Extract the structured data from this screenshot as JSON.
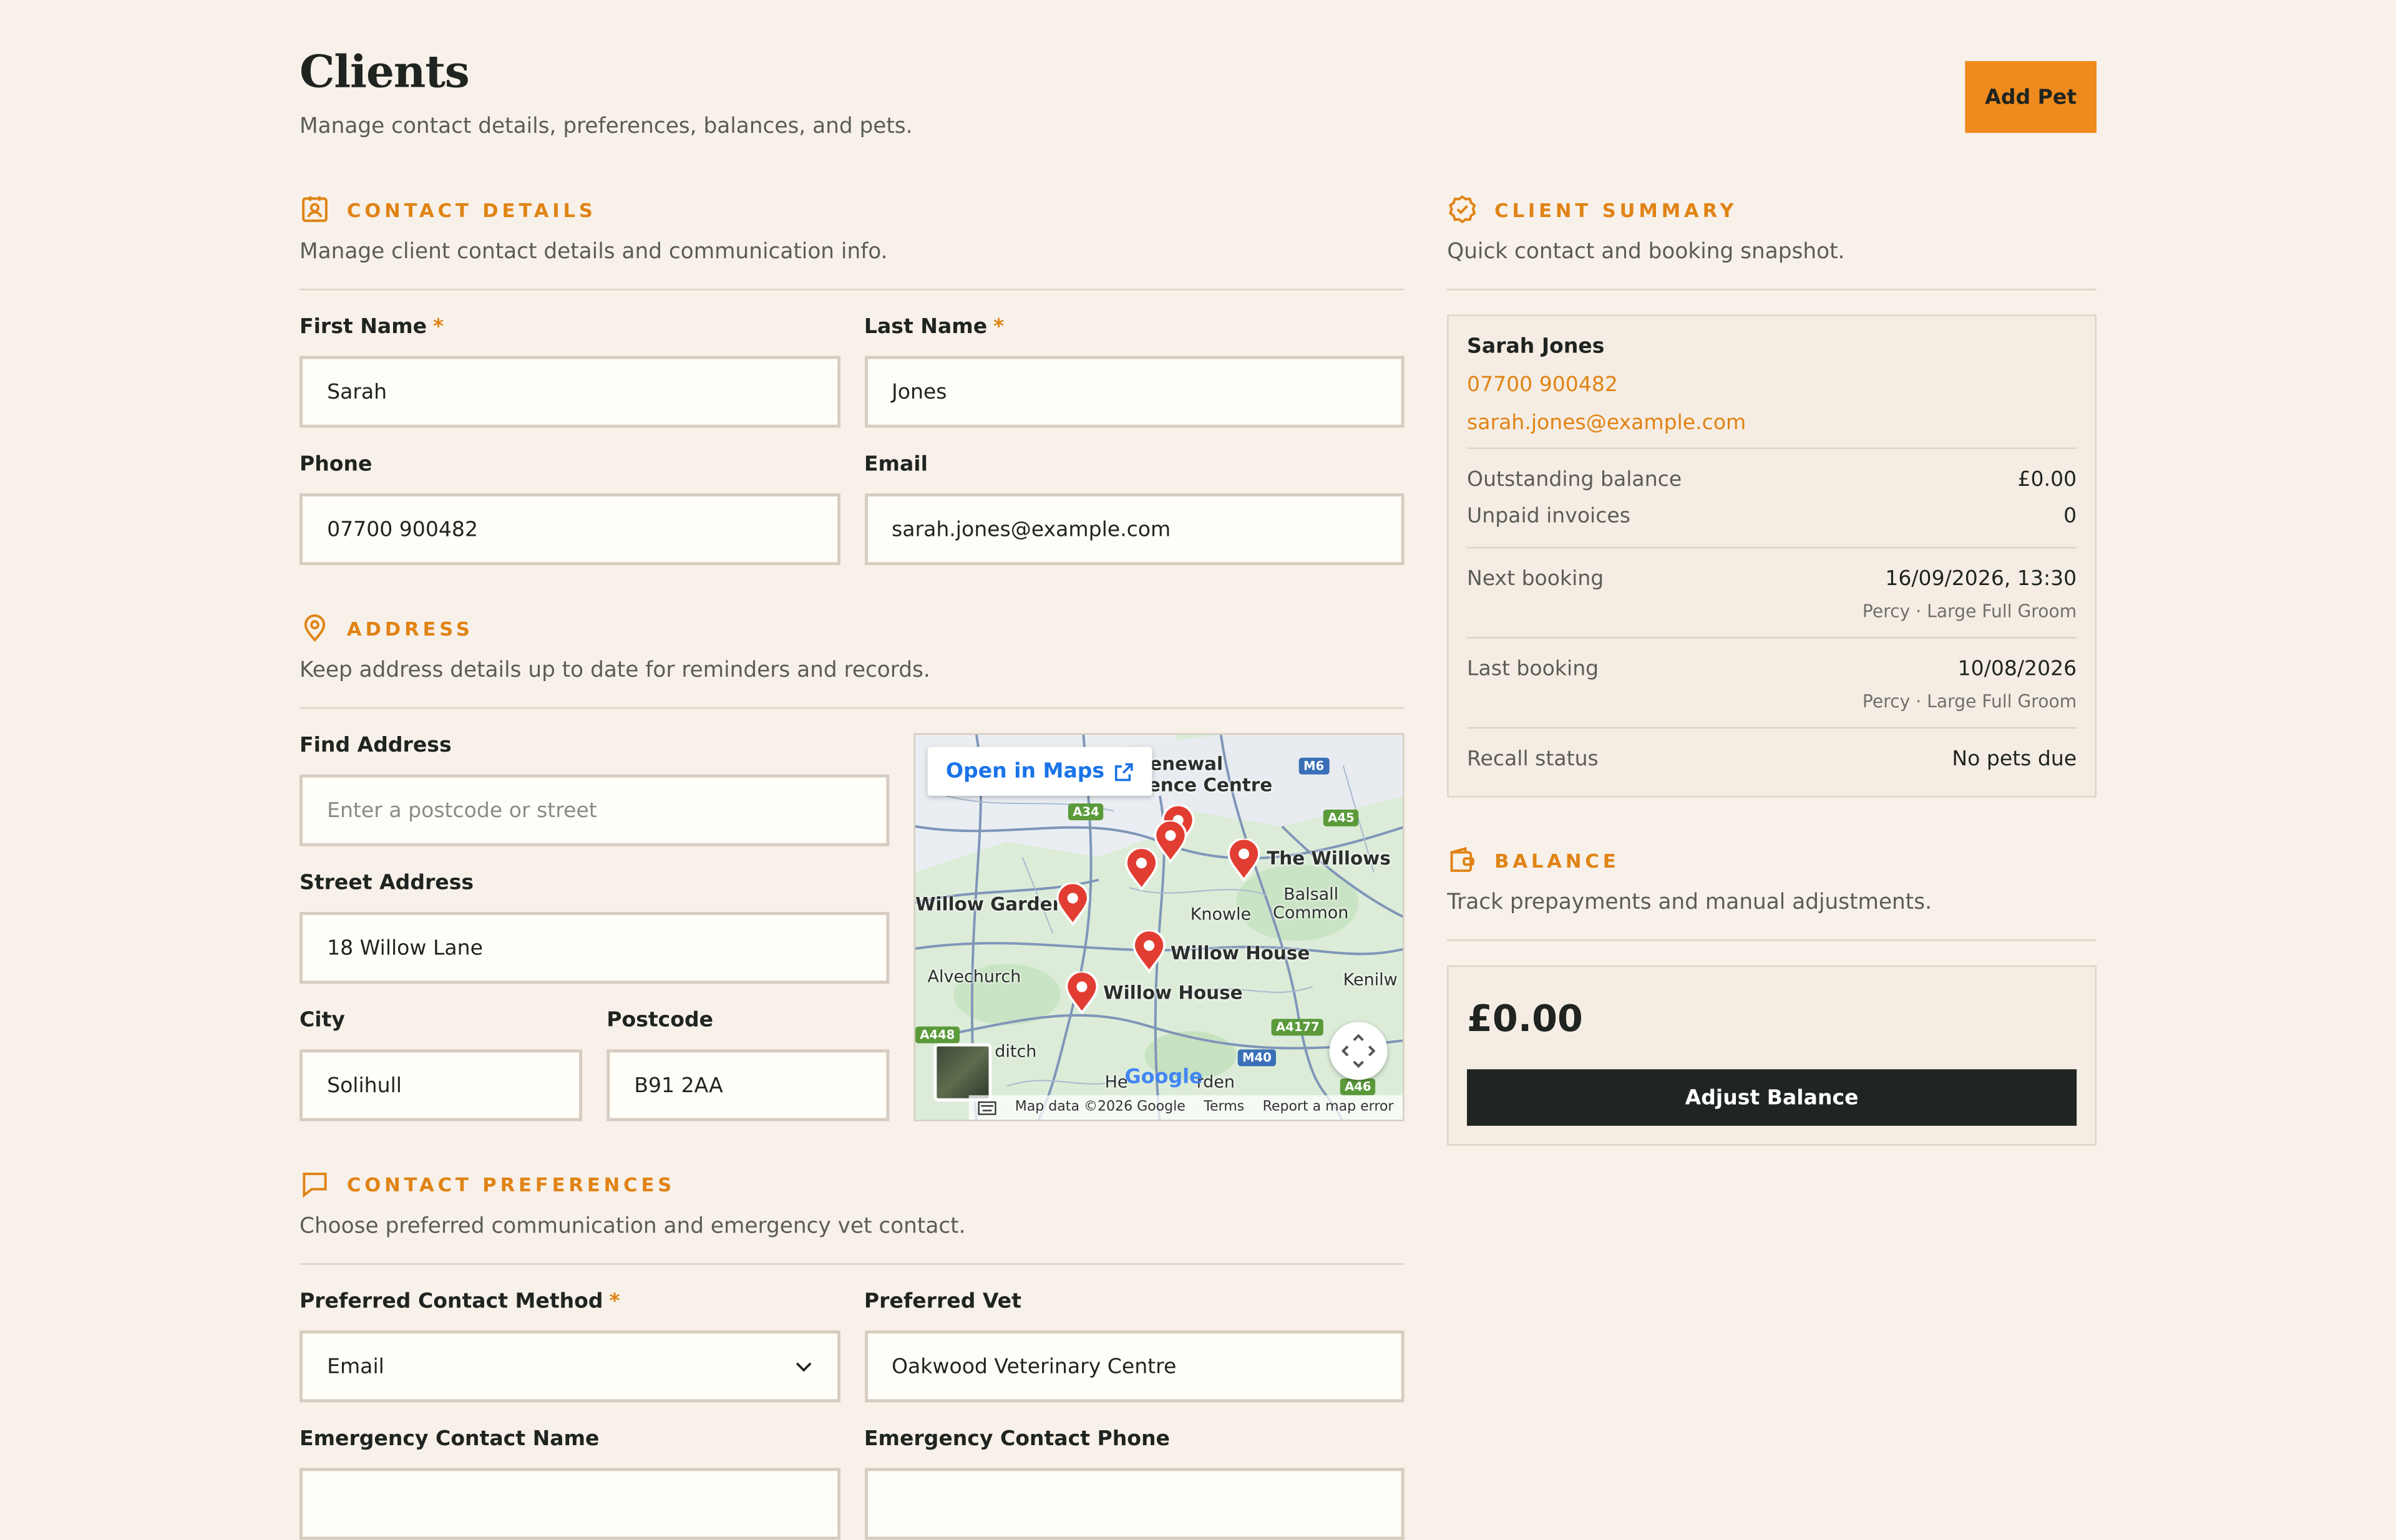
{
  "header": {
    "title": "Clients",
    "subtitle": "Manage contact details, preferences, balances, and pets.",
    "add_pet_label": "Add Pet"
  },
  "contact": {
    "title": "CONTACT DETAILS",
    "desc": "Manage client contact details and communication info.",
    "first_name_label": "First Name",
    "first_name_value": "Sarah",
    "last_name_label": "Last Name",
    "last_name_value": "Jones",
    "phone_label": "Phone",
    "phone_value": "07700 900482",
    "email_label": "Email",
    "email_value": "sarah.jones@example.com",
    "required_mark": "*"
  },
  "address": {
    "title": "ADDRESS",
    "desc": "Keep address details up to date for reminders and records.",
    "find_label": "Find Address",
    "find_placeholder": "Enter a postcode or street",
    "street_label": "Street Address",
    "street_value": "18 Willow Lane",
    "city_label": "City",
    "city_value": "Solihull",
    "postcode_label": "Postcode",
    "postcode_value": "B91 2AA"
  },
  "map": {
    "open_in_maps": "Open in Maps",
    "places": [
      "Renewal",
      "ference Centre",
      "Willow Gardens",
      "The Willows",
      "Balsall",
      "Common",
      "Knowle",
      "Willow House",
      "Willow House",
      "Alvechurch",
      "Kenilw",
      "ditch",
      "He",
      "rden"
    ],
    "roads": [
      "A34",
      "M6",
      "A45",
      "A448",
      "A4177",
      "M40",
      "A46"
    ],
    "footer": [
      "Map data ©2026 Google",
      "Terms",
      "Report a map error"
    ],
    "logo": "Google"
  },
  "preferences": {
    "title": "CONTACT PREFERENCES",
    "desc": "Choose preferred communication and emergency vet contact.",
    "method_label": "Preferred Contact Method",
    "method_value": "Email",
    "vet_label": "Preferred Vet",
    "vet_value": "Oakwood Veterinary Centre",
    "emergency_name_label": "Emergency Contact Name",
    "emergency_phone_label": "Emergency Contact Phone"
  },
  "summary": {
    "title": "CLIENT SUMMARY",
    "desc": "Quick contact and booking snapshot.",
    "name": "Sarah Jones",
    "phone": "07700 900482",
    "email": "sarah.jones@example.com",
    "outstanding_label": "Outstanding balance",
    "outstanding_value": "£0.00",
    "unpaid_label": "Unpaid invoices",
    "unpaid_value": "0",
    "next_label": "Next booking",
    "next_value": "16/09/2026, 13:30",
    "next_sub": "Percy · Large Full Groom",
    "last_label": "Last booking",
    "last_value": "10/08/2026",
    "last_sub": "Percy · Large Full Groom",
    "recall_label": "Recall status",
    "recall_value": "No pets due"
  },
  "balance": {
    "title": "BALANCE",
    "desc": "Track prepayments and manual adjustments.",
    "amount": "£0.00",
    "adjust_label": "Adjust Balance"
  },
  "colors": {
    "accent": "#e08315",
    "button": "#ef8a1d",
    "dark": "#1f2521",
    "background": "#f8f1e9"
  }
}
